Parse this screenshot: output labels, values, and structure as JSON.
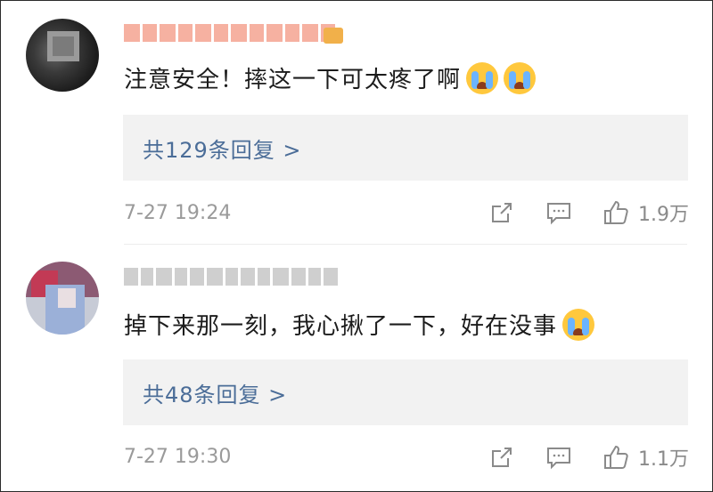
{
  "comments": [
    {
      "text": "注意安全！摔这一下可太疼了啊",
      "emojis": [
        "crying-face-emoji",
        "crying-face-emoji"
      ],
      "replies_label": "共129条回复 >",
      "timestamp": "7-27 19:24",
      "likes": "1.9万"
    },
    {
      "text": "掉下来那一刻，我心揪了一下，好在没事",
      "emojis": [
        "crying-face-emoji"
      ],
      "replies_label": "共48条回复 >",
      "timestamp": "7-27 19:30",
      "likes": "1.1万"
    }
  ],
  "colors": {
    "link": "#4b6d98",
    "meta": "#9a9a9a",
    "reply_bg": "#f2f2f2"
  },
  "icons": [
    "share-icon",
    "comment-icon",
    "like-icon"
  ]
}
